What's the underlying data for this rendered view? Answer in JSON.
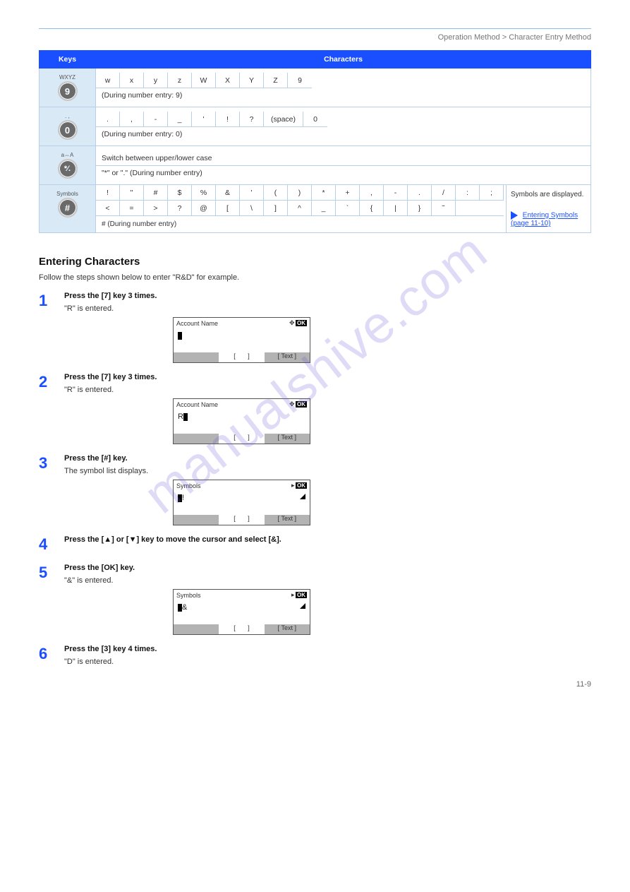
{
  "header": "Operation Method > Character Entry Method",
  "watermark": "manualshive.com",
  "table": {
    "head": {
      "keys": "Keys",
      "chars": "Characters"
    },
    "rows": [
      {
        "key_label": "WXYZ",
        "key_face": "9",
        "line1": [
          "w",
          "x",
          "y",
          "z",
          "W",
          "X",
          "Y",
          "Z",
          "9"
        ],
        "line2_note": "(During number entry: 9)"
      },
      {
        "key_label": ". ,",
        "key_face": "0",
        "line1": [
          ".",
          ",",
          "-",
          "_",
          "'",
          "!",
          "?",
          "(space)",
          "0"
        ],
        "line2_note": "(During number entry: 0)"
      },
      {
        "key_label": "a⇔A",
        "key_face": "*⁄.",
        "line1_full": "Switch between upper/lower case",
        "line2_full": "\"*\" or \".\" (During number entry)"
      }
    ],
    "symbols": {
      "key_label": "Symbols",
      "key_face": "#",
      "grid": [
        [
          "!",
          "\"",
          "#",
          "$",
          "%",
          "&",
          "'",
          "(",
          ")",
          "*",
          "+",
          ",",
          "-",
          ".",
          "/",
          ":",
          ";"
        ],
        [
          "<",
          "=",
          ">",
          "?",
          "@",
          "[",
          "\\",
          "]",
          "^",
          "_",
          "`",
          "{",
          "|",
          "}",
          "˜"
        ]
      ],
      "note": "# (During number entry)",
      "side_text": "Symbols are displayed.",
      "side_link_label": "Entering Symbols (page 11-10)"
    }
  },
  "section_title": "Entering Characters",
  "section_desc": "Follow the steps shown below to enter \"R&D\" for example.",
  "steps": [
    {
      "n": "1",
      "title": "Press the [7] key 3 times.",
      "sub": "\"R\" is entered.",
      "lcd": {
        "header": "Account Name",
        "arrows": "✥",
        "body_prefix": "",
        "body_text": "",
        "cursor_after": "",
        "footer_left_gray": true,
        "footer_right": "Text",
        "tri": false
      }
    },
    {
      "n": "2",
      "title": "Press the [7] key 3 times.",
      "sub": "\"R\" is entered.",
      "lcd": {
        "header": "Account Name",
        "arrows": "✥",
        "body_prefix": "R",
        "body_text": "",
        "cursor_after": "",
        "footer_left_gray": true,
        "footer_right": "Text",
        "tri": false
      }
    },
    {
      "n": "3",
      "title": "Press the [#] key.",
      "sub": "The symbol list displays.",
      "lcd": {
        "header": "Symbols",
        "arrows": "▸",
        "body_prefix": "",
        "body_text": "!",
        "footer_left_gray": true,
        "footer_right": "Text",
        "tri": true
      }
    },
    {
      "n": "4",
      "title": "Press the [▲] or [▼] key to move the cursor and select [&].",
      "sub": "",
      "lcd": null
    },
    {
      "n": "5",
      "title": "Press the [OK] key.",
      "sub": "\"&\" is entered.",
      "lcd": {
        "header": "Symbols",
        "arrows": "▸",
        "body_prefix": "",
        "body_text": "&",
        "footer_left_gray": true,
        "footer_right": "Text",
        "tri": true
      }
    },
    {
      "n": "6",
      "title": "Press the [3] key 4 times.",
      "sub": "\"D\" is entered.",
      "lcd": null
    }
  ],
  "page_number": "11-9"
}
